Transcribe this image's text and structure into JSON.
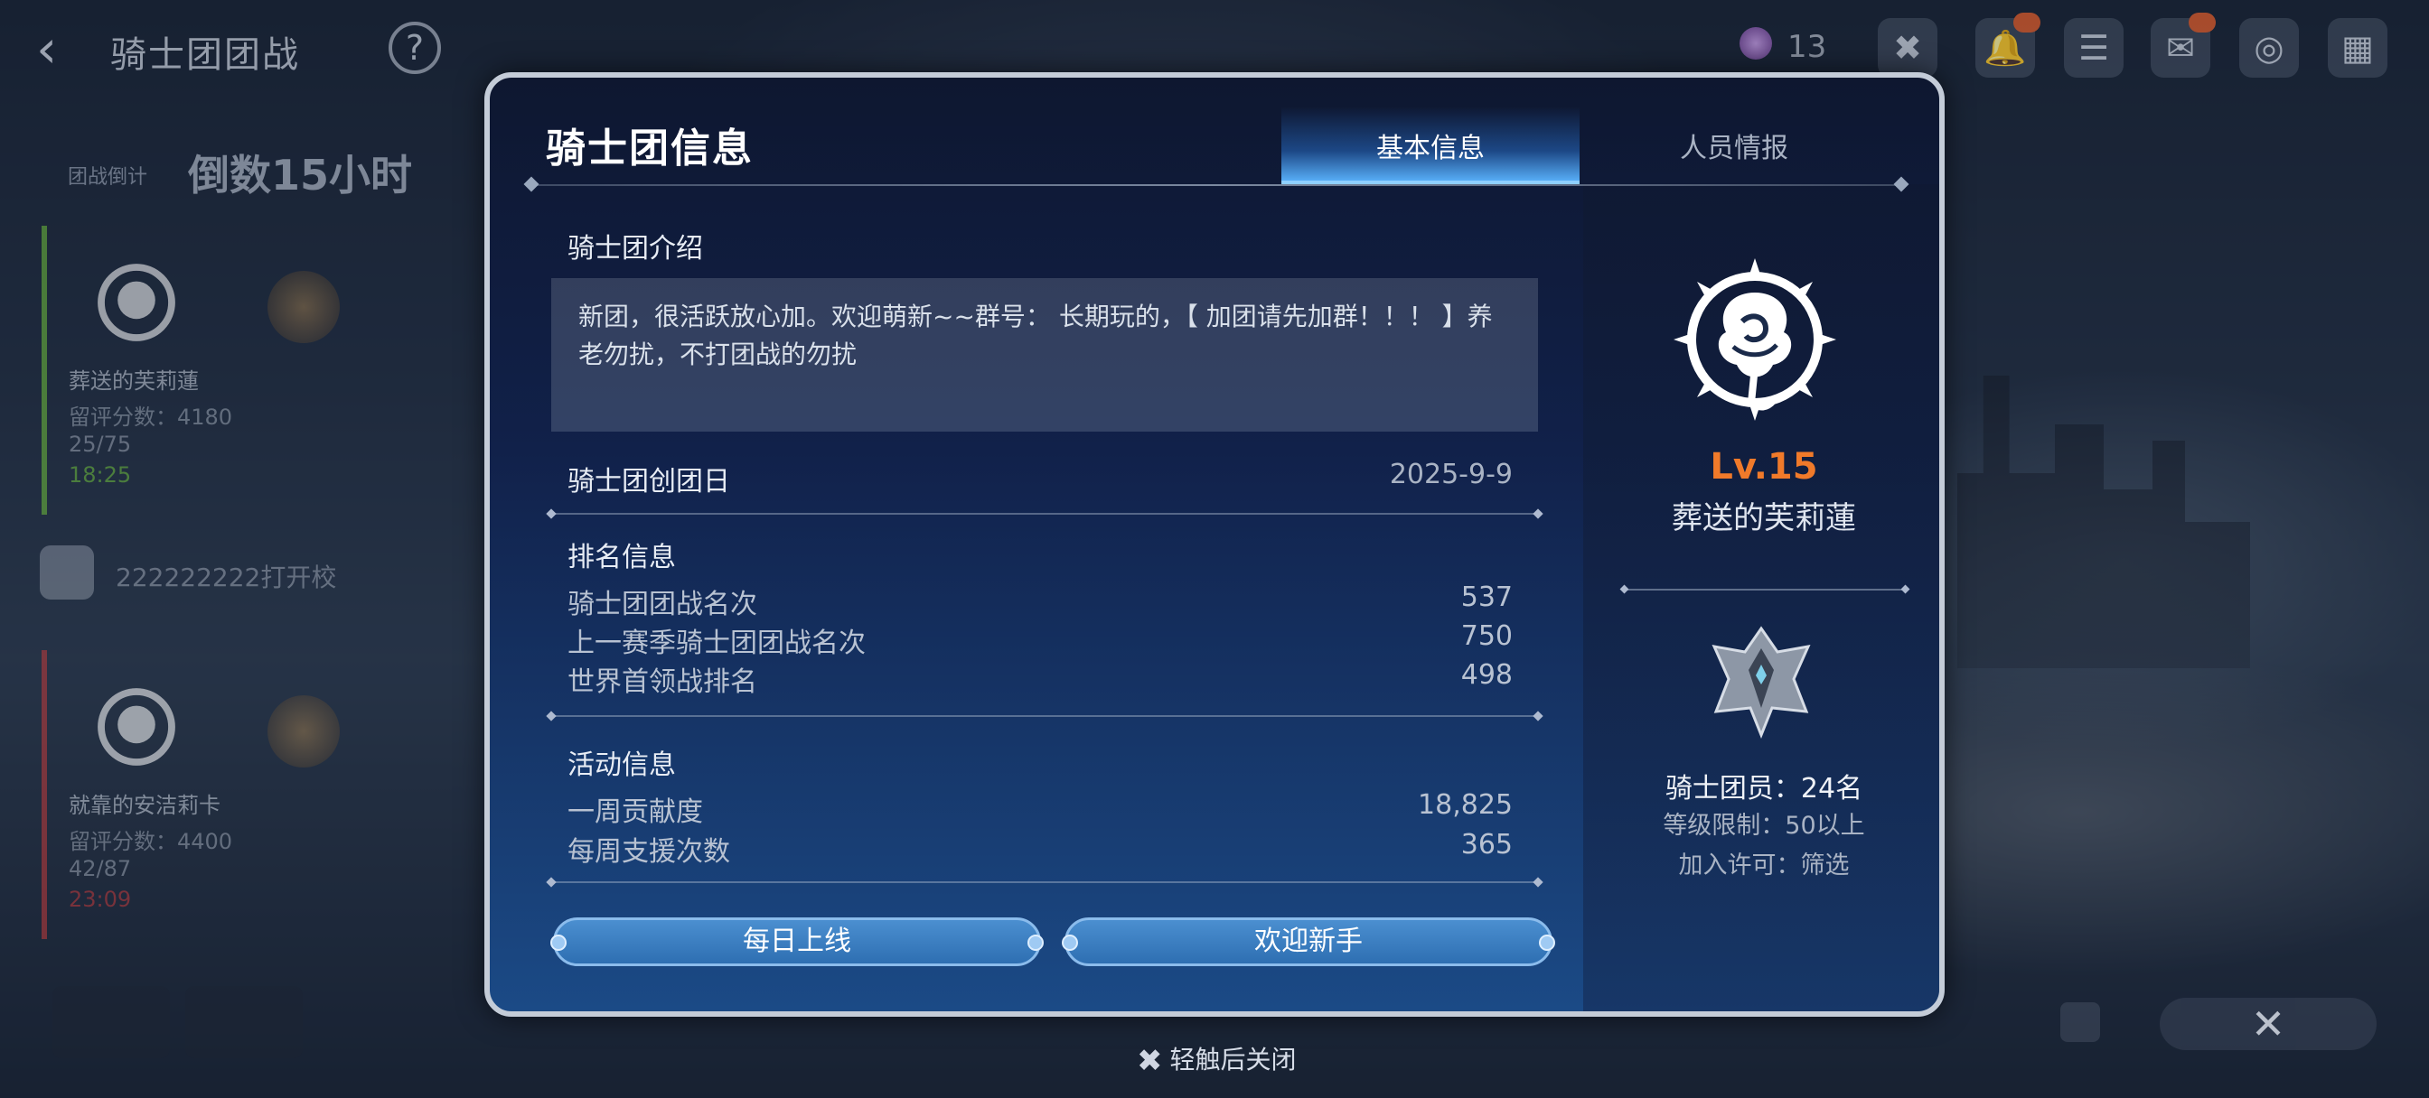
{
  "background": {
    "page_title": "骑士团团战",
    "countdown_label": "团战倒计",
    "countdown": "倒数15小时",
    "cards": [
      {
        "name": "葬送的芙莉蓮",
        "score": "留评分数：4180",
        "count": "25/75",
        "time": "18:25",
        "bar_color": "#6fbf3b"
      },
      {
        "name": "就靠的安洁莉卡",
        "score": "留评分数：4400",
        "count": "42/87",
        "time": "23:09",
        "bar_color": "#c23b3b"
      }
    ],
    "side_row_text": "222222222打开校",
    "hud_gem_count": "13"
  },
  "modal": {
    "title": "骑士团信息",
    "tabs": [
      {
        "label": "基本信息",
        "active": true
      },
      {
        "label": "人员情报",
        "active": false
      }
    ],
    "intro": {
      "label": "骑士团介绍",
      "text": "新团，很活跃放心加。欢迎萌新~~群号：                        长期玩的，【 加团请先加群！！！ 】养老勿扰，不打团战的勿扰"
    },
    "founded": {
      "label": "骑士团创团日",
      "value": "2025-9-9"
    },
    "ranking": {
      "label": "排名信息",
      "rows": [
        {
          "label": "骑士团团战名次",
          "value": "537"
        },
        {
          "label": "上一赛季骑士团团战名次",
          "value": "750"
        },
        {
          "label": "世界首领战排名",
          "value": "498"
        }
      ]
    },
    "activity": {
      "label": "活动信息",
      "rows": [
        {
          "label": "一周贡献度",
          "value": "18,825"
        },
        {
          "label": "每周支援次数",
          "value": "365"
        }
      ]
    },
    "tags": [
      "每日上线",
      "欢迎新手"
    ],
    "guild": {
      "level": "Lv.15",
      "name": "葬送的芙莉蓮",
      "members": "骑士团员：24名",
      "level_limit": "等级限制：50以上",
      "join_permission": "加入许可：筛选"
    }
  },
  "footer": {
    "tap_close": "轻触后关闭"
  },
  "colors": {
    "accent_blue": "#4b8fd0",
    "level_orange": "#f07a2a",
    "tab_active": "#8fd0ff"
  }
}
